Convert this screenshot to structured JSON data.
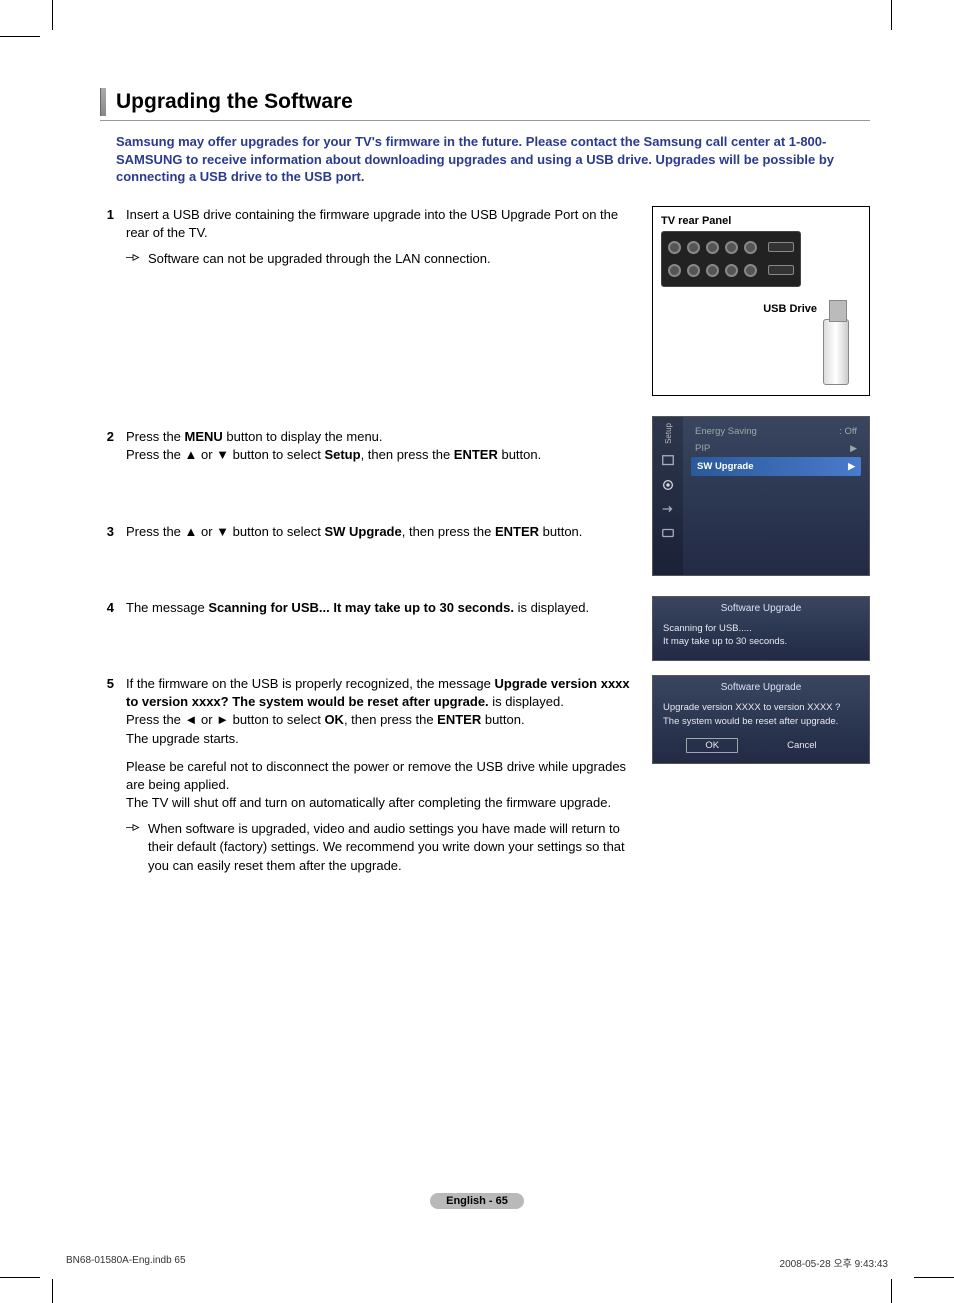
{
  "title": "Upgrading the Software",
  "intro": "Samsung may offer upgrades for your TV's firmware in the future. Please contact the Samsung call center at 1-800-SAMSUNG to receive information about downloading upgrades and using a USB drive. Upgrades will be possible by connecting a USB drive to the USB port.",
  "steps": {
    "s1_a": "Insert a USB drive containing the firmware upgrade into the USB Upgrade Port on the rear of the TV.",
    "s1_note": "Software can not be upgraded through the LAN connection.",
    "s2_a": "Press the ",
    "s2_menu": "MENU",
    "s2_b": " button to display the menu.",
    "s2_c": "Press the ▲ or ▼ button to select ",
    "s2_setup": "Setup",
    "s2_d": ", then press the ",
    "s2_enter": "ENTER",
    "s2_e": " button.",
    "s3_a": "Press the ▲ or ▼ button to select ",
    "s3_sw": "SW Upgrade",
    "s3_b": ", then press the ",
    "s3_enter": "ENTER",
    "s3_c": " button.",
    "s4_a": "The message ",
    "s4_msg": "Scanning for USB... It may take up to 30 seconds.",
    "s4_b": " is displayed.",
    "s5_a": "If the firmware on the USB is properly recognized, the message ",
    "s5_msg": "Upgrade version xxxx to version xxxx? The system would be reset after upgrade.",
    "s5_b": " is displayed.",
    "s5_c": "Press the ◄ or ► button to select ",
    "s5_ok": "OK",
    "s5_d": ", then press the ",
    "s5_enter": "ENTER",
    "s5_e": " button.",
    "s5_f": "The upgrade starts.",
    "s5_warn1": "Please be careful not to disconnect the power or remove the USB drive while upgrades are being applied.",
    "s5_warn2": "The TV will shut off and turn on automatically after completing the firmware upgrade.",
    "s5_note": "When software is upgraded, video and audio settings you have made will return to their default (factory) settings. We recommend you write down your settings so that you can easily reset them after the upgrade."
  },
  "fig": {
    "rear_panel": "TV rear Panel",
    "usb_drive": "USB Drive"
  },
  "osd": {
    "tab": "Setup",
    "row1_label": "Energy Saving",
    "row1_val": ": Off",
    "row2_label": "PIP",
    "row3_label": "SW Upgrade"
  },
  "dlg1": {
    "title": "Software Upgrade",
    "line1": "Scanning for USB.....",
    "line2": "It may take up to 30 seconds."
  },
  "dlg2": {
    "title": "Software Upgrade",
    "body": "Upgrade version XXXX to version XXXX ? The system would be reset after upgrade.",
    "ok": "OK",
    "cancel": "Cancel"
  },
  "footer": {
    "page": "English - 65",
    "doc_left": "BN68-01580A-Eng.indb   65",
    "doc_right": "2008-05-28   오후 9:43:43"
  }
}
